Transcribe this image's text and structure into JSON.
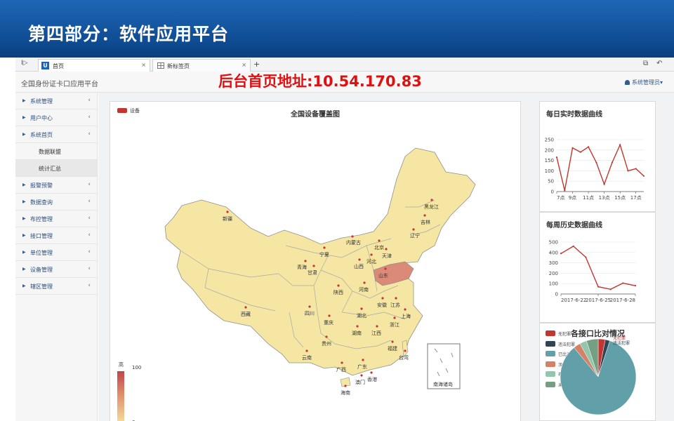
{
  "slide": {
    "title": "第四部分：软件应用平台"
  },
  "tabs": [
    {
      "label": "首页",
      "close": "×"
    },
    {
      "label": "新标签页",
      "close": "×"
    }
  ],
  "toolbar": {
    "play": "I▷",
    "add": "+",
    "restore": "⧉",
    "undo": "↶"
  },
  "header": {
    "app_name": "全国身份证卡口应用平台",
    "backend_url": "后台首页地址:10.54.170.83",
    "user": "系统管理员▾"
  },
  "sidebar": {
    "items": [
      {
        "label": "系统管理",
        "sub": false
      },
      {
        "label": "用户中心",
        "sub": false
      },
      {
        "label": "系统首页",
        "sub": false
      },
      {
        "label": "数据联盟",
        "sub": true
      },
      {
        "label": "统计汇总",
        "sub": true
      },
      {
        "label": "报警预警",
        "sub": false
      },
      {
        "label": "数据查询",
        "sub": false
      },
      {
        "label": "布控管理",
        "sub": false
      },
      {
        "label": "接口管理",
        "sub": false
      },
      {
        "label": "单位管理",
        "sub": false
      },
      {
        "label": "设备管理",
        "sub": false
      },
      {
        "label": "辖区管理",
        "sub": false
      }
    ]
  },
  "map": {
    "title": "全国设备覆盖图",
    "legend": "设备",
    "legend_color": "#c23531",
    "visual_map": {
      "high": "高",
      "max": "100",
      "min": "0"
    },
    "provinces": [
      "新疆",
      "西藏",
      "青海",
      "甘肃",
      "宁夏",
      "内蒙古",
      "黑龙江",
      "吉林",
      "辽宁",
      "北京",
      "天津",
      "河北",
      "山西",
      "山东",
      "河南",
      "陕西",
      "四川",
      "重庆",
      "湖北",
      "安徽",
      "江苏",
      "上海",
      "浙江",
      "湖南",
      "江西",
      "贵州",
      "云南",
      "福建",
      "台湾",
      "广西",
      "广东",
      "香港",
      "澳门",
      "海南"
    ],
    "highlight": "山东",
    "south_sea_label": "南海诸岛"
  },
  "chart_data": [
    {
      "type": "line",
      "title": "每日实时数据曲线",
      "x": [
        "7点",
        "8点",
        "9点",
        "10点",
        "11点",
        "12点",
        "13点",
        "14点",
        "15点",
        "16点",
        "17点",
        "18点"
      ],
      "xticks": [
        "7点",
        "9点",
        "11点",
        "13点",
        "15点",
        "17点"
      ],
      "values": [
        165,
        5,
        210,
        190,
        215,
        140,
        35,
        140,
        225,
        100,
        110,
        75
      ],
      "ylim": [
        0,
        250
      ],
      "yticks": [
        0,
        50,
        100,
        150,
        200,
        250
      ],
      "color": "#c23531"
    },
    {
      "type": "line",
      "title": "每周历史数据曲线",
      "x": [
        "2017-6-22",
        "2017-6-23",
        "2017-6-24",
        "2017-6-25",
        "2017-6-26",
        "2017-6-27",
        "2017-6-28"
      ],
      "xticks": [
        "2017-6-22",
        "2017-6-25",
        "2017-6-28"
      ],
      "values": [
        390,
        460,
        355,
        70,
        45,
        105,
        80
      ],
      "ylim": [
        0,
        500
      ],
      "yticks": [
        0,
        100,
        200,
        300,
        400,
        500
      ],
      "color": "#c23531"
    },
    {
      "type": "pie",
      "title": "各接口比对情况",
      "series": [
        {
          "name": "无犯罪",
          "value": 3,
          "color": "#c23531"
        },
        {
          "name": "违法犯罪",
          "value": 2,
          "color": "#2f4554"
        },
        {
          "name": "已比对",
          "value": 84,
          "color": "#61a0a8"
        },
        {
          "name": "涉稳数据",
          "value": 3,
          "color": "#d48265"
        },
        {
          "name": "布控",
          "value": 3,
          "color": "#91c7ae"
        },
        {
          "name": "未比对",
          "value": 5,
          "color": "#749f83"
        }
      ]
    }
  ]
}
